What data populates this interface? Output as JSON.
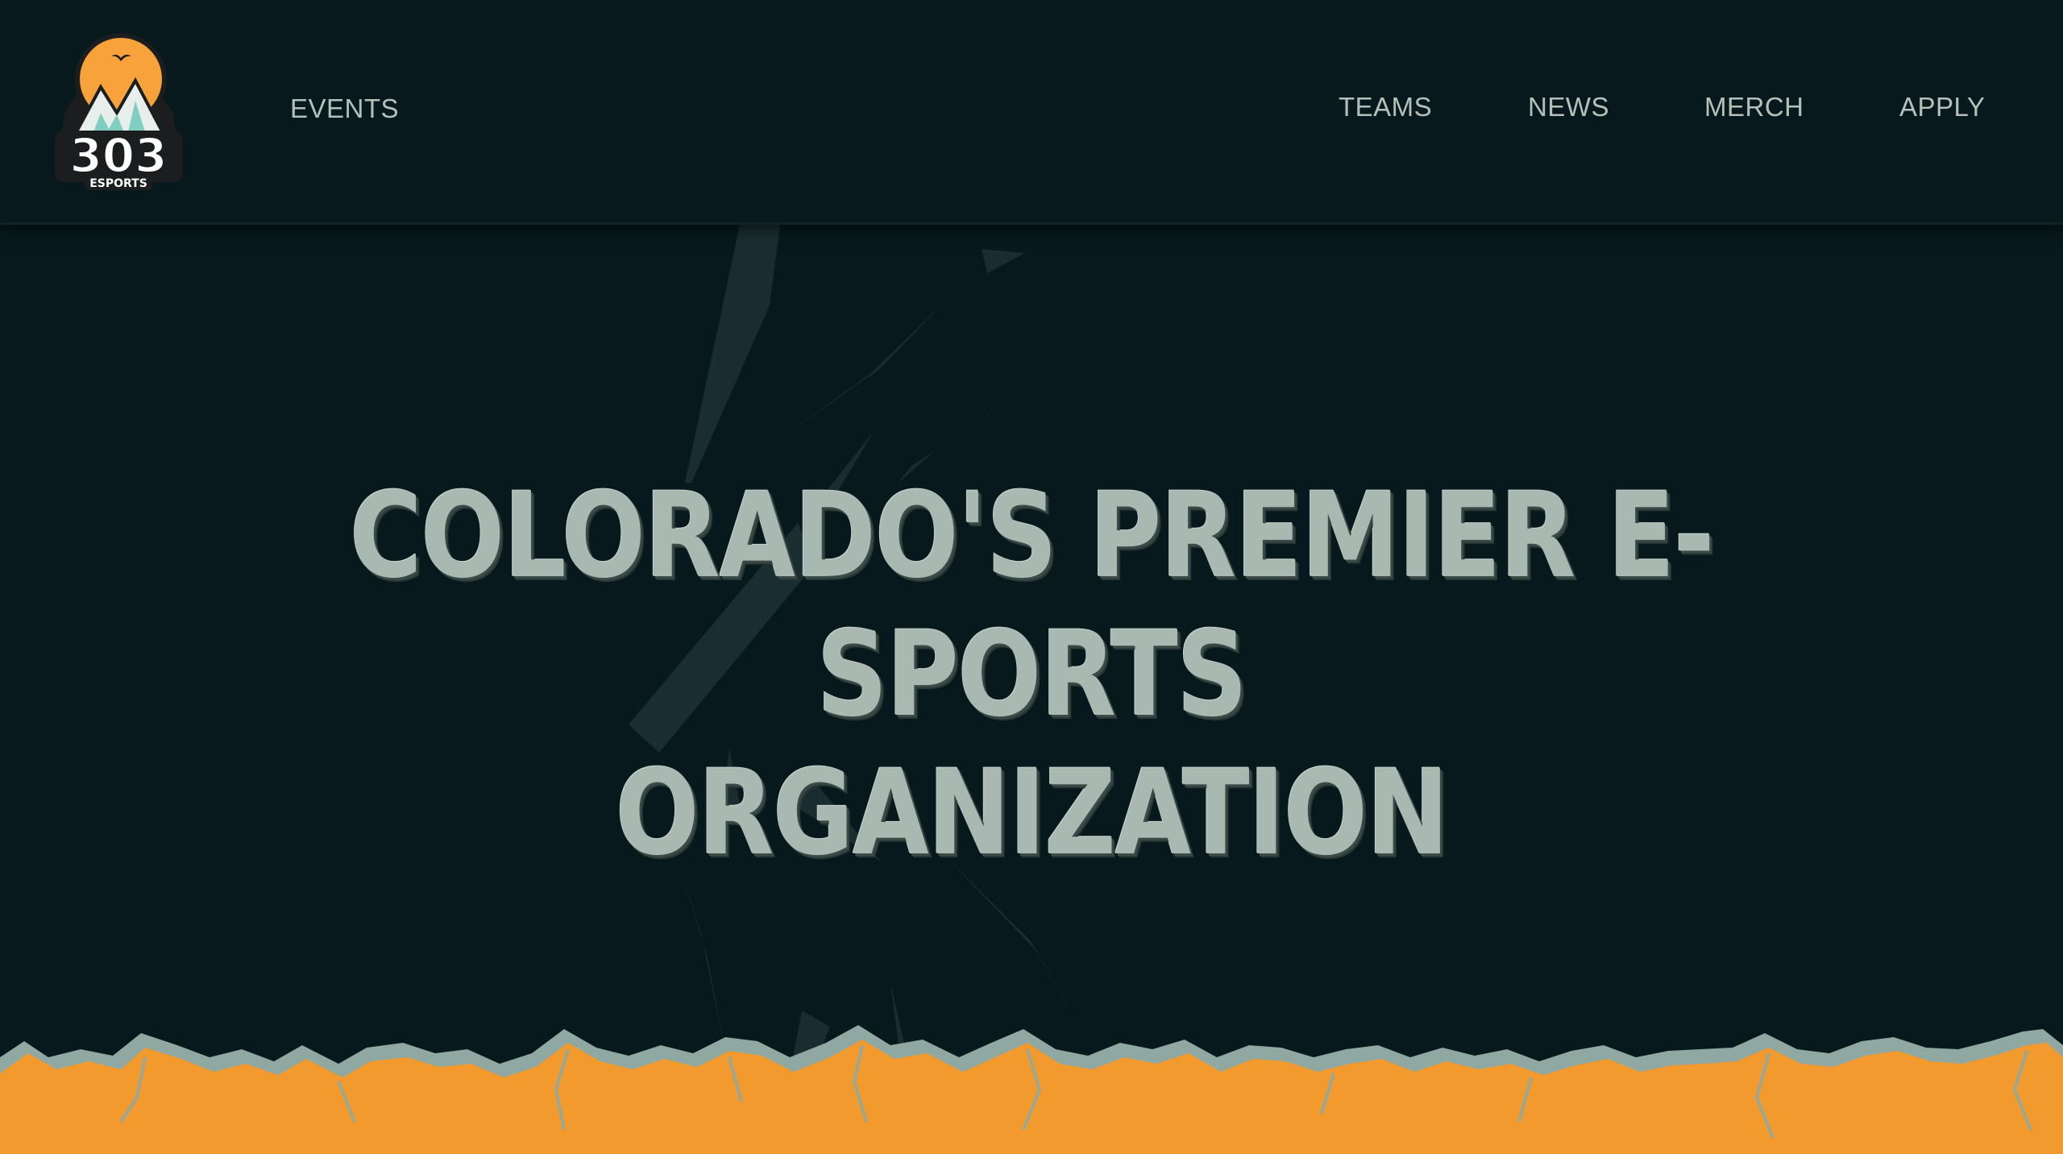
{
  "brand": {
    "logo_number": "303",
    "logo_sub": "ESPORTS"
  },
  "nav": {
    "left": [
      {
        "label": "EVENTS"
      }
    ],
    "right": [
      {
        "label": "TEAMS"
      },
      {
        "label": "NEWS"
      },
      {
        "label": "MERCH"
      },
      {
        "label": "APPLY"
      }
    ]
  },
  "hero": {
    "title_line1": "COLORADO'S PREMIER E-SPORTS",
    "title_line2": "ORGANIZATION"
  },
  "colors": {
    "background": "#08191d",
    "nav_text": "#b5c0b8",
    "title_text": "#a9b9b1",
    "accent_orange": "#f7a23b",
    "accent_teal": "#7fcfc0"
  }
}
